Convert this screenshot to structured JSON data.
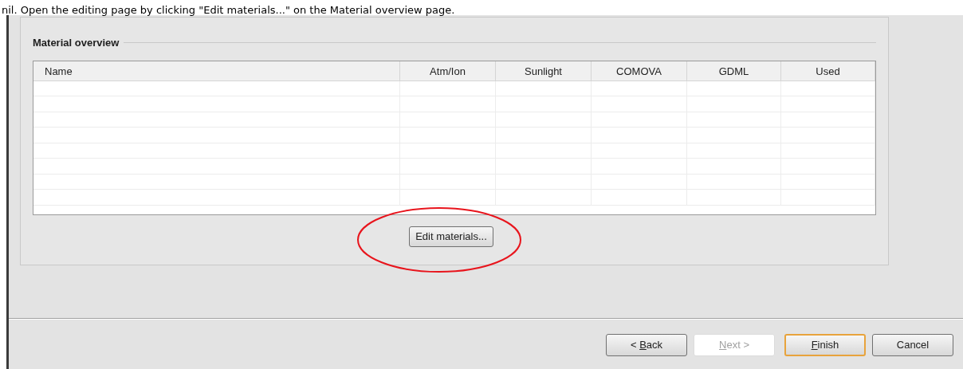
{
  "caption": "nil. Open the editing page by clicking \"Edit materials...\" on the Material overview page.",
  "group": {
    "title": "Material overview"
  },
  "table": {
    "columns": [
      "Name",
      "Atm/Ion",
      "Sunlight",
      "COMOVA",
      "GDML",
      "Used"
    ]
  },
  "edit_button": {
    "label": "Edit materials...",
    "highlighted": true
  },
  "buttons": [
    {
      "label": "< Back",
      "mnemonic": true,
      "disabled": false,
      "default": false
    },
    {
      "label": "Next >",
      "mnemonic": true,
      "disabled": true,
      "default": false
    },
    {
      "label": "Finish",
      "mnemonic": true,
      "disabled": false,
      "default": true
    },
    {
      "label": "Cancel",
      "mnemonic": false,
      "disabled": false,
      "default": false
    }
  ]
}
